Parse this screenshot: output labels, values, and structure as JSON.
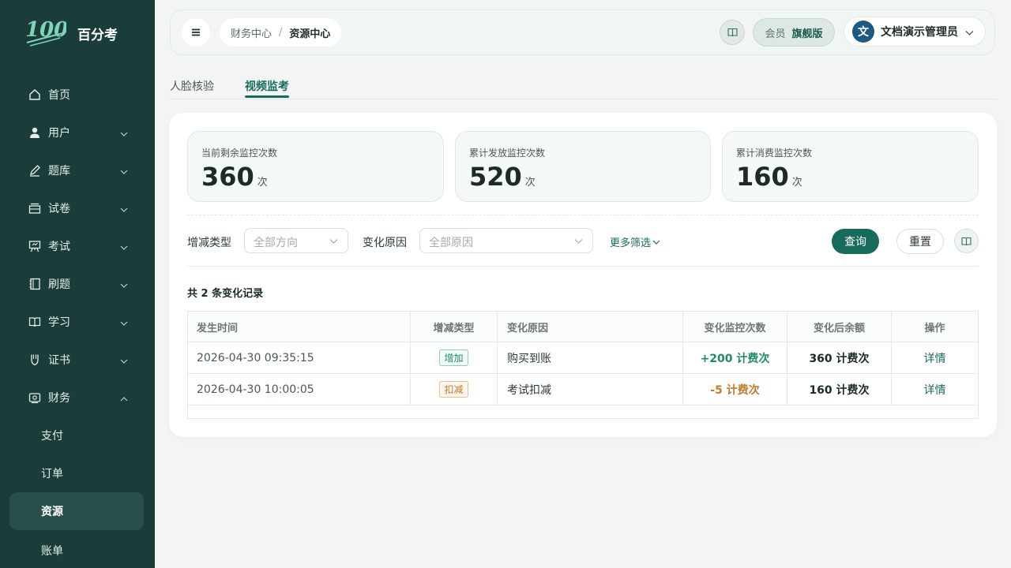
{
  "app": {
    "logo_mark": "100",
    "name": "百分考"
  },
  "sidebar": {
    "items": [
      {
        "label": "首页",
        "icon": "home-icon",
        "has_chevron": false
      },
      {
        "label": "用户",
        "icon": "user-icon",
        "has_chevron": true
      },
      {
        "label": "题库",
        "icon": "pen-icon",
        "has_chevron": true
      },
      {
        "label": "试卷",
        "icon": "paper-tray-icon",
        "has_chevron": true
      },
      {
        "label": "考试",
        "icon": "easel-icon",
        "has_chevron": true
      },
      {
        "label": "刷题",
        "icon": "notebook-icon",
        "has_chevron": true
      },
      {
        "label": "学习",
        "icon": "open-book-icon",
        "has_chevron": true
      },
      {
        "label": "证书",
        "icon": "certificate-icon",
        "has_chevron": true
      },
      {
        "label": "财务",
        "icon": "wallet-icon",
        "has_chevron": true,
        "expanded": true
      }
    ],
    "finance_sub": [
      {
        "label": "支付"
      },
      {
        "label": "订单"
      },
      {
        "label": "资源",
        "active": true
      },
      {
        "label": "账单"
      }
    ]
  },
  "header": {
    "breadcrumb": [
      "财务中心",
      "资源中心"
    ],
    "breadcrumb_sep": "/",
    "member_label": "会员",
    "member_plan": "旗舰版",
    "user_avatar": "文",
    "user_name": "文档演示管理员"
  },
  "tabs": [
    {
      "label": "人脸核验",
      "active": false
    },
    {
      "label": "视频监考",
      "active": true
    }
  ],
  "stats": [
    {
      "label": "当前剩余监控次数",
      "value": "360",
      "unit": "次"
    },
    {
      "label": "累计发放监控次数",
      "value": "520",
      "unit": "次"
    },
    {
      "label": "累计消费监控次数",
      "value": "160",
      "unit": "次"
    }
  ],
  "filters": {
    "type_label": "增减类型",
    "type_placeholder": "全部方向",
    "reason_label": "变化原因",
    "reason_placeholder": "全部原因",
    "more_label": "更多筛选",
    "query_label": "查询",
    "reset_label": "重置"
  },
  "records": {
    "count_text": "共 2 条变化记录",
    "columns": [
      "发生时间",
      "增减类型",
      "变化原因",
      "变化监控次数",
      "变化后余额",
      "操作"
    ],
    "rows": [
      {
        "time": "2026-04-30 09:35:15",
        "type": "增加",
        "reason": "购买到账",
        "change": "+200 计费次",
        "after": "360 计费次",
        "op": "详情"
      },
      {
        "time": "2026-04-30 10:00:05",
        "type": "扣减",
        "reason": "考试扣减",
        "change": "-5 计费次",
        "after": "160 计费次",
        "op": "详情"
      }
    ]
  },
  "colors": {
    "sidebar_bg": "#1b3d39",
    "accent": "#176b5c",
    "increase": "#1f8a66",
    "decrease": "#c07a2a"
  }
}
